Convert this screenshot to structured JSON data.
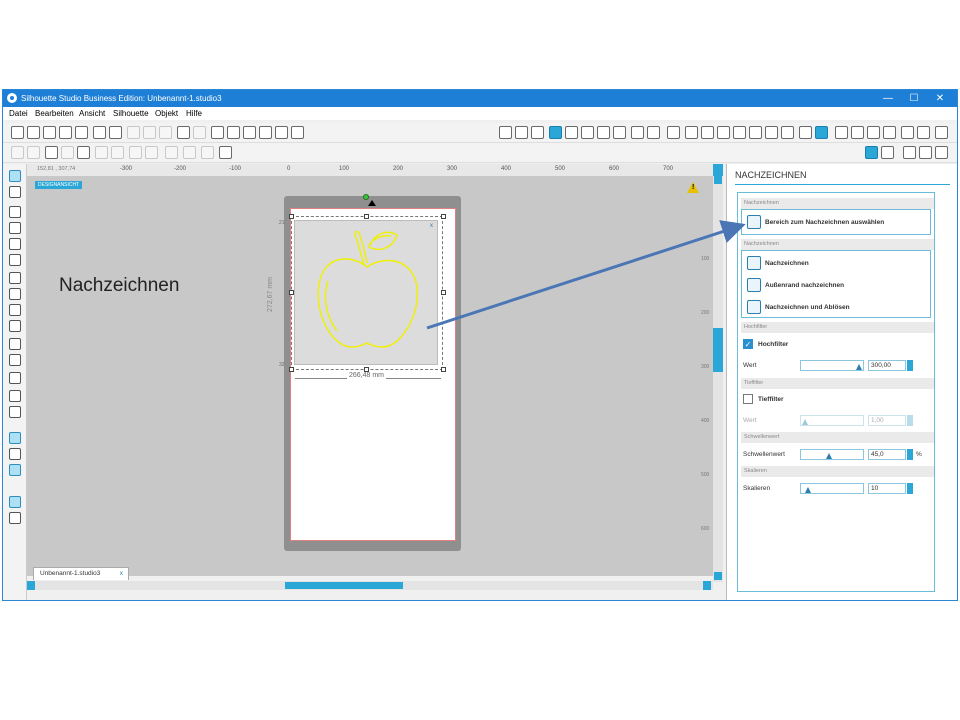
{
  "window": {
    "title": "Silhouette Studio Business Edition: Unbenannt-1.studio3",
    "controls": {
      "minimize": "—",
      "maximize": "☐",
      "close": "✕"
    }
  },
  "menu": [
    "Datei",
    "Bearbeiten",
    "Ansicht",
    "Silhouette",
    "Objekt",
    "Hilfe"
  ],
  "coords": "152,81 , 307,74",
  "design_tag": "DESIGNANSICHT",
  "ruler_h": [
    "-300",
    "-200",
    "-100",
    "0",
    "100",
    "200",
    "300",
    "400",
    "500",
    "600",
    "700"
  ],
  "ruler_v": [
    "100",
    "200",
    "300",
    "400",
    "500",
    "600"
  ],
  "selection": {
    "width_label": "266,48 mm",
    "height_label": "272,67 mm"
  },
  "doc_tab": {
    "name": "Unbenannt-1.studio3",
    "close": "x"
  },
  "annotation": "Nachzeichnen",
  "panel": {
    "title": "NACHZEICHNEN",
    "s1_header": "Nachzeichnen",
    "select_area_button": "Bereich zum Nachzeichnen auswählen",
    "s2_header": "Nachzeichnen",
    "trace_options": [
      "Nachzeichnen",
      "Außenrand nachzeichnen",
      "Nachzeichnen und Ablösen"
    ],
    "highpass": {
      "header": "Hochfilter",
      "checkbox": "Hochfilter",
      "value_label": "Wert",
      "value": "300,00",
      "checked": true,
      "slider_fraction": 1.0
    },
    "lowpass": {
      "header": "Tieffilter",
      "checkbox": "Tieffilter",
      "value_label": "Wert",
      "value": "1,00",
      "checked": false,
      "slider_fraction": 0.0
    },
    "threshold": {
      "header": "Schwellenwert",
      "label": "Schwellenwert",
      "value": "45,0",
      "unit": "%",
      "slider_fraction": 0.45
    },
    "scale": {
      "header": "Skalieren",
      "label": "Skalieren",
      "value": "10",
      "slider_fraction": 0.05
    }
  },
  "colors": {
    "titlebar": "#1e7fd6",
    "accent": "#2aa7d6",
    "trace_line": "#f0f000",
    "arrow": "#4a76b6",
    "mat": "#8f8f8f",
    "canvas": "#c8c8c8"
  }
}
